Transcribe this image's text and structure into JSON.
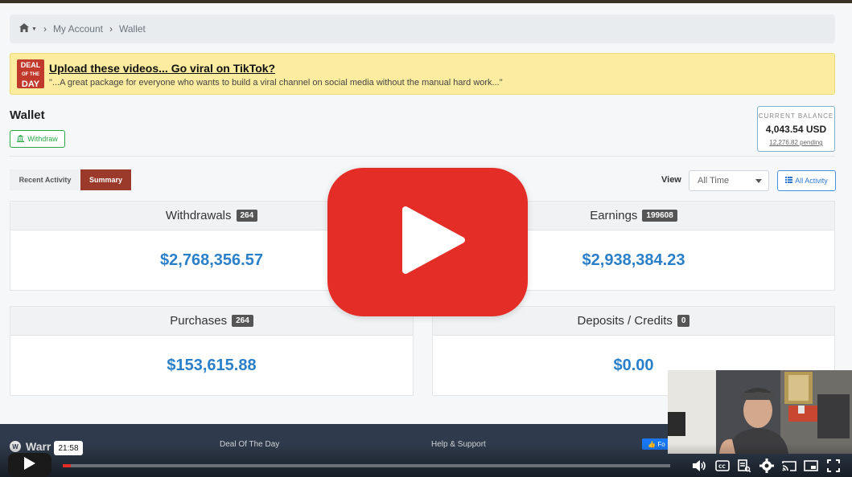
{
  "breadcrumb": {
    "home_symbol": "▼",
    "items": [
      "My Account",
      "Wallet"
    ]
  },
  "deal": {
    "logo_lines": [
      "DEAL",
      "OF THE",
      "DAY"
    ],
    "title": "Upload these videos... Go viral on TikTok?",
    "text": "\"...A great package for everyone who wants to build a viral channel on social media without the manual hard work...\""
  },
  "wallet": {
    "title": "Wallet",
    "withdraw_label": "Withdraw",
    "balance_label": "CURRENT BALANCE",
    "balance_amount": "4,043.54 USD",
    "balance_pending": "12,276.82 pending"
  },
  "tabs": {
    "recent": "Recent Activity",
    "summary": "Summary"
  },
  "filter": {
    "view_label": "View",
    "view_value": "All Time",
    "all_activity_label": "All Activity"
  },
  "cards": {
    "withdrawals": {
      "label": "Withdrawals",
      "count": "264",
      "value": "$2,768,356.57"
    },
    "earnings": {
      "label": "Earnings",
      "count": "199608",
      "value": "$2,938,384.23"
    },
    "purchases": {
      "label": "Purchases",
      "count": "264",
      "value": "$153,615.88"
    },
    "deposits": {
      "label": "Deposits / Credits",
      "count": "0",
      "value": "$0.00"
    }
  },
  "footer": {
    "brand": "Warr   Plus",
    "col1": "Deal Of The Day",
    "col2": "Help & Support",
    "fb": "Fo"
  },
  "player": {
    "time": "21:58",
    "colors": {
      "accent": "#e52d27"
    },
    "icons": [
      "volume-icon",
      "captions-icon",
      "transcript-icon",
      "settings-icon",
      "cast-icon",
      "miniplayer-icon",
      "fullscreen-icon"
    ]
  }
}
